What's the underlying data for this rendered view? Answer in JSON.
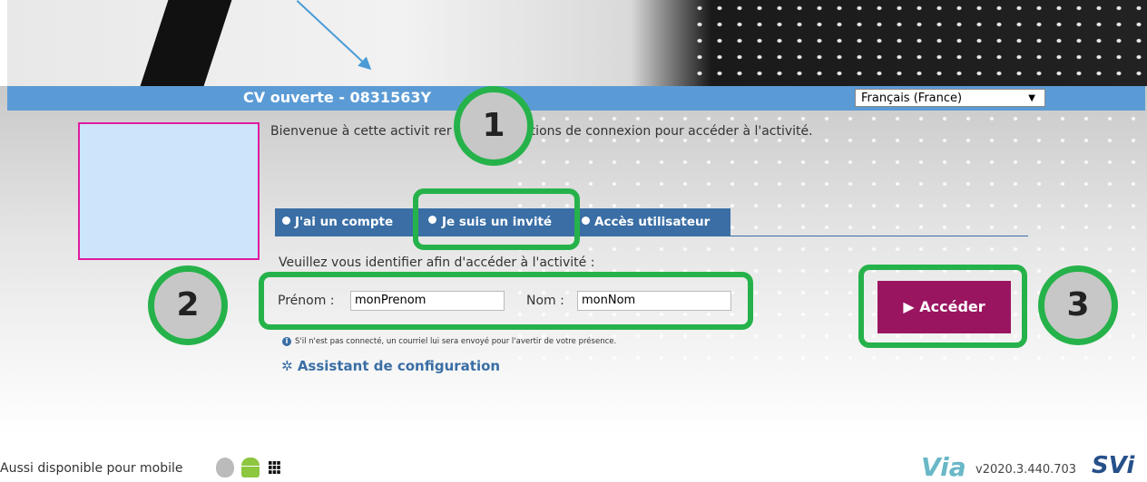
{
  "header": {
    "title": "CV ouverte - 0831563Y",
    "language": "Français (France)"
  },
  "welcome_text": "Bienvenue à cette activit           rer vos informations de connexion pour accéder à l'activité.",
  "tabs": [
    {
      "label": "J'ai un compte",
      "selected": false
    },
    {
      "label": "Je suis un invité",
      "selected": true
    },
    {
      "label": "Accès utilisateur",
      "selected": false
    }
  ],
  "form": {
    "instruction": "Veuillez vous identifier afin d'accéder à l'activité :",
    "firstname_label": "Prénom :",
    "firstname_value": "monPrenom",
    "lastname_label": "Nom :",
    "lastname_value": "monNom",
    "info_text": "S'il n'est pas connecté, un courriel lui sera envoyé pour l'avertir de votre présence.",
    "wizard_label": "Assistant de configuration",
    "access_label": "Accéder"
  },
  "callouts": [
    "1",
    "2",
    "3"
  ],
  "footer": {
    "mobile_text": "Aussi disponible pour mobile",
    "via_logo": "Via",
    "version": "v2020.3.440.703",
    "svi_logo": "SVi"
  },
  "colors": {
    "title_bar": "#5b9bd5",
    "tab": "#3a6ea5",
    "access_button": "#9a1560",
    "callout": "#26b24a",
    "avatar_border": "#e01aa0"
  }
}
